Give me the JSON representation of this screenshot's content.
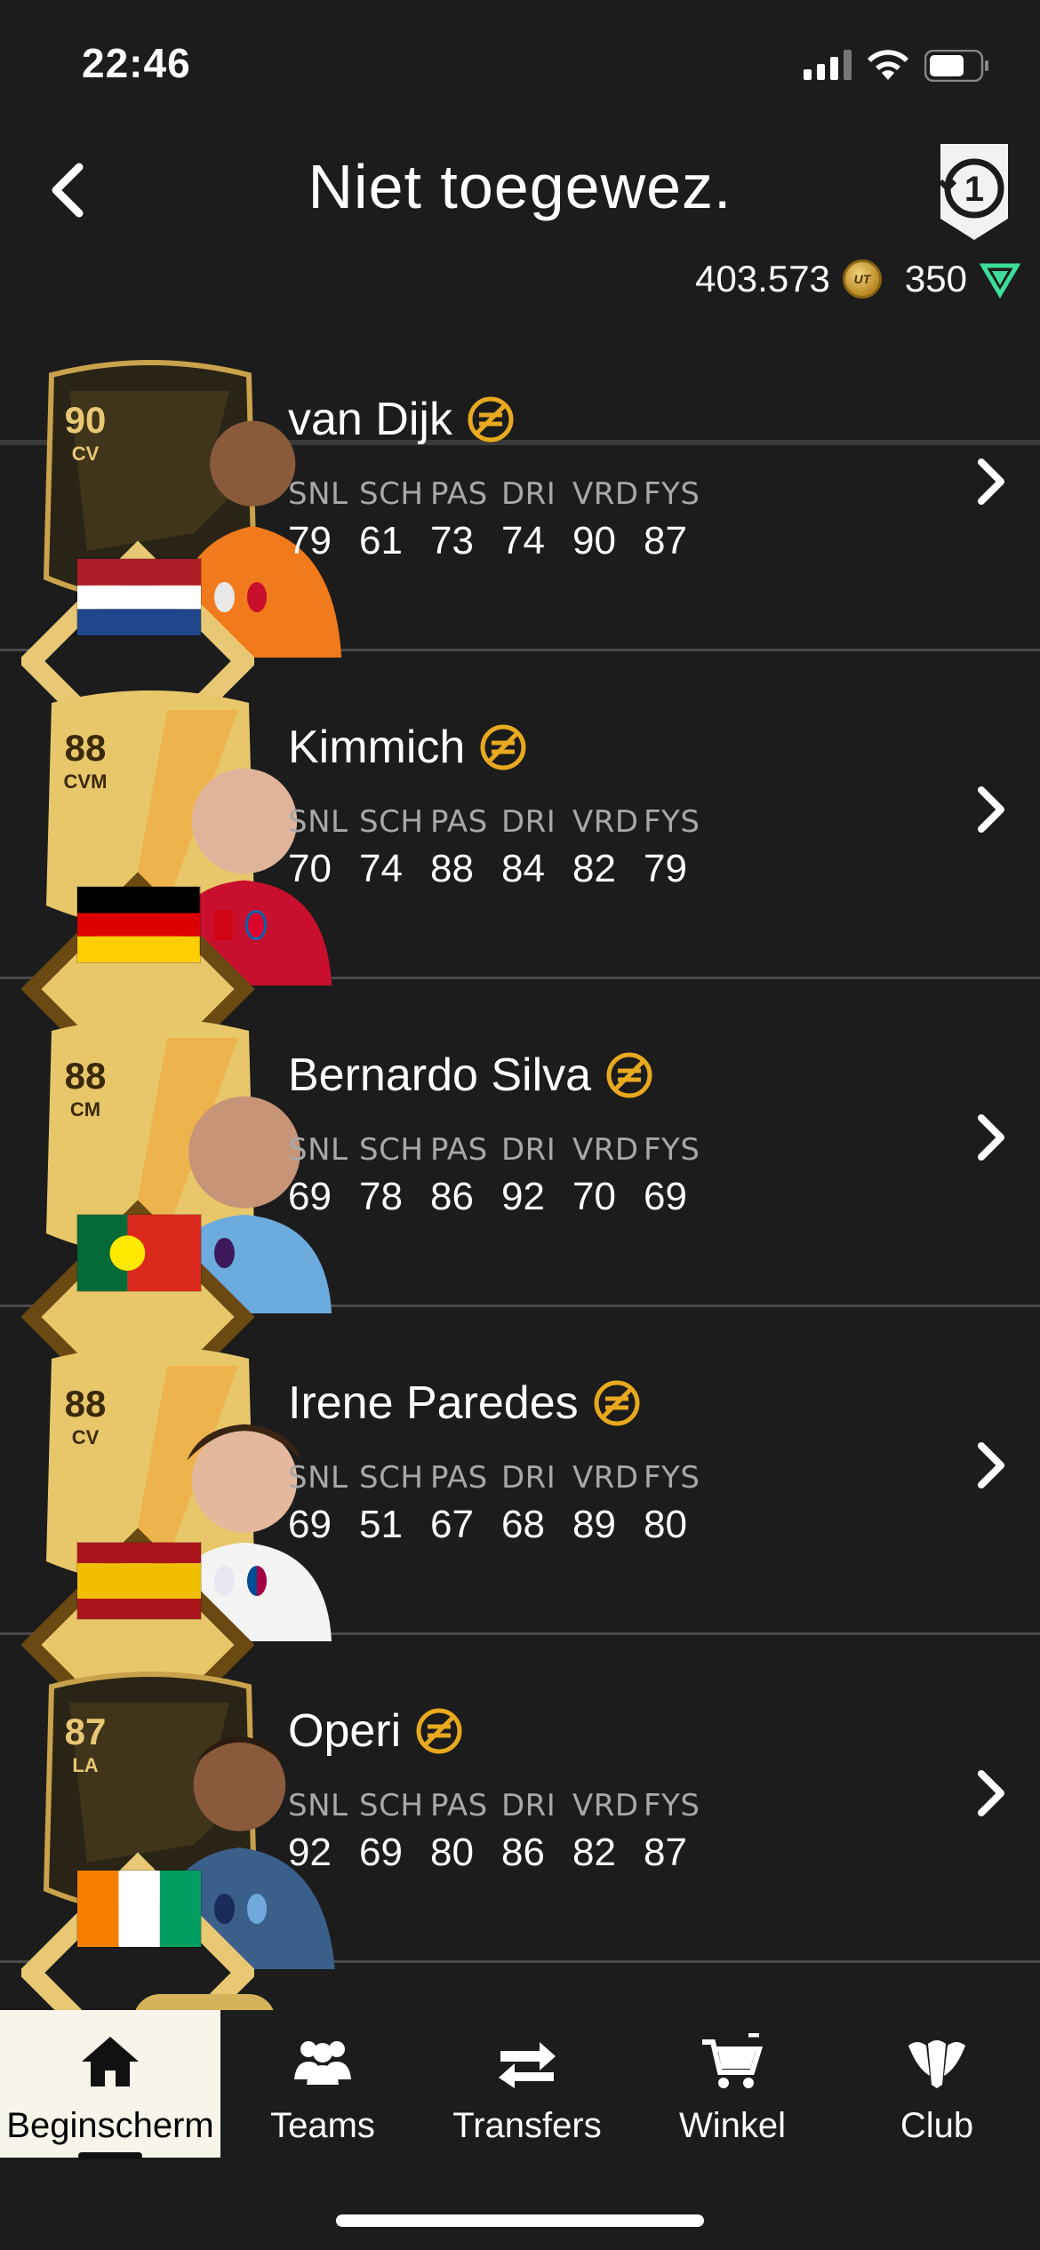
{
  "status_bar": {
    "time": "22:46"
  },
  "header": {
    "title": "Niet toegewez."
  },
  "currency": {
    "coins": "403.573",
    "coin_symbol": "UT",
    "points": "350"
  },
  "stat_labels": [
    "SNL",
    "SCH",
    "PAS",
    "DRI",
    "VRD",
    "FYS"
  ],
  "players": [
    {
      "name": "van Dijk",
      "rating": "90",
      "position": "CV",
      "card_type": "special",
      "stats": [
        "79",
        "61",
        "73",
        "74",
        "90",
        "87"
      ]
    },
    {
      "name": "Kimmich",
      "rating": "88",
      "position": "CVM",
      "card_type": "gold",
      "stats": [
        "70",
        "74",
        "88",
        "84",
        "82",
        "79"
      ]
    },
    {
      "name": "Bernardo Silva",
      "rating": "88",
      "position": "CM",
      "card_type": "gold",
      "stats": [
        "69",
        "78",
        "86",
        "92",
        "70",
        "69"
      ]
    },
    {
      "name": "Irene Paredes",
      "rating": "88",
      "position": "CV",
      "card_type": "gold",
      "stats": [
        "69",
        "51",
        "67",
        "68",
        "89",
        "80"
      ]
    },
    {
      "name": "Operi",
      "rating": "87",
      "position": "LA",
      "card_type": "special",
      "stats": [
        "92",
        "69",
        "80",
        "86",
        "82",
        "87"
      ]
    }
  ],
  "tabs": [
    {
      "label": "Beginscherm",
      "icon": "home-icon",
      "active": true
    },
    {
      "label": "Teams",
      "icon": "teams-icon",
      "active": false
    },
    {
      "label": "Transfers",
      "icon": "transfers-icon",
      "active": false
    },
    {
      "label": "Winkel",
      "icon": "cart-icon",
      "active": false
    },
    {
      "label": "Club",
      "icon": "club-icon",
      "active": false
    }
  ],
  "colors": {
    "background": "#1c1c1c",
    "gold_accent": "#e8a91e",
    "points_accent": "#3ddc97",
    "active_tab": "#f7f4ea"
  }
}
